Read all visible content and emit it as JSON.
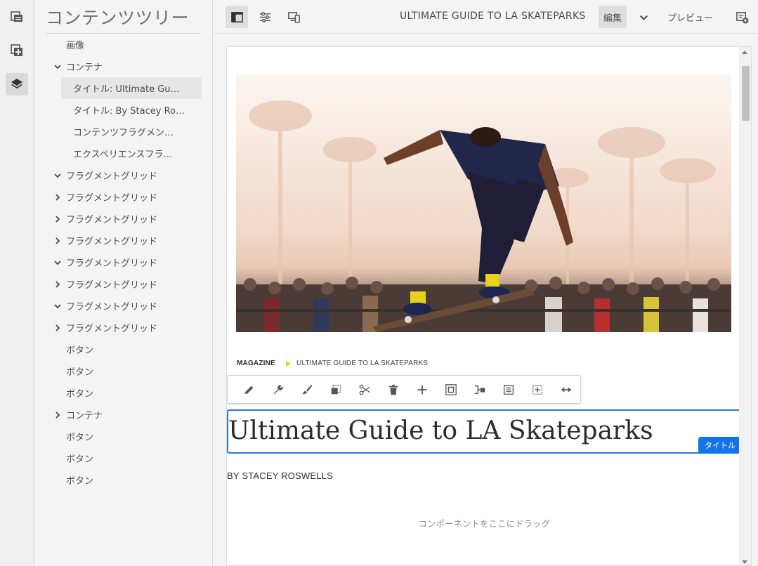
{
  "rail": {
    "icons": [
      "page-info-icon",
      "add-component-icon",
      "layers-icon"
    ]
  },
  "tree": {
    "title": "コンテンツツリー",
    "items": [
      {
        "label": "画像",
        "level": 0,
        "chevron": "none"
      },
      {
        "label": "コンテナ",
        "level": 0,
        "chevron": "down"
      },
      {
        "label": "タイトル: Ultimate Gu…",
        "level": 1,
        "chevron": "none",
        "selected": true
      },
      {
        "label": "タイトル: By Stacey Ro…",
        "level": 1,
        "chevron": "none"
      },
      {
        "label": "コンテンツフラグメン…",
        "level": 1,
        "chevron": "none"
      },
      {
        "label": "エクスペリエンスフラ…",
        "level": 1,
        "chevron": "none"
      },
      {
        "label": "フラグメントグリッド",
        "level": 0,
        "chevron": "down"
      },
      {
        "label": "フラグメントグリッド",
        "level": 0,
        "chevron": "right"
      },
      {
        "label": "フラグメントグリッド",
        "level": 0,
        "chevron": "right"
      },
      {
        "label": "フラグメントグリッド",
        "level": 0,
        "chevron": "right"
      },
      {
        "label": "フラグメントグリッド",
        "level": 0,
        "chevron": "down"
      },
      {
        "label": "フラグメントグリッド",
        "level": 0,
        "chevron": "right"
      },
      {
        "label": "フラグメントグリッド",
        "level": 0,
        "chevron": "down"
      },
      {
        "label": "フラグメントグリッド",
        "level": 0,
        "chevron": "right"
      },
      {
        "label": "ボタン",
        "level": 0,
        "chevron": "none"
      },
      {
        "label": "ボタン",
        "level": 0,
        "chevron": "none"
      },
      {
        "label": "ボタン",
        "level": 0,
        "chevron": "none"
      },
      {
        "label": "コンテナ",
        "level": 0,
        "chevron": "right"
      },
      {
        "label": "ボタン",
        "level": 0,
        "chevron": "none"
      },
      {
        "label": "ボタン",
        "level": 0,
        "chevron": "none"
      },
      {
        "label": "ボタン",
        "level": 0,
        "chevron": "none"
      }
    ]
  },
  "topbar": {
    "page_name": "ULTIMATE GUIDE TO LA SKATEPARKS",
    "edit_label": "編集",
    "preview_label": "プレビュー"
  },
  "page": {
    "breadcrumb": {
      "parent": "MAGAZINE",
      "current": "ULTIMATE GUIDE TO LA SKATEPARKS"
    },
    "title": "Ultimate Guide to LA Skateparks",
    "title_badge": "タイトル",
    "byline": "BY STACEY ROSWELLS",
    "dropzone": "コンポーネントをここにドラッグ"
  },
  "component_toolbar": {
    "actions": [
      "edit-icon",
      "configure-icon",
      "style-icon",
      "copy-icon",
      "cut-icon",
      "delete-icon",
      "insert-icon",
      "select-parent-icon",
      "convert-to-experience-fragment-icon",
      "layout-icon",
      "group-icon",
      "resize-icon"
    ]
  },
  "colors": {
    "accent": "#1473e6",
    "selection_border": "#2c74d6",
    "breadcrumb_arrow": "#f5d000"
  }
}
